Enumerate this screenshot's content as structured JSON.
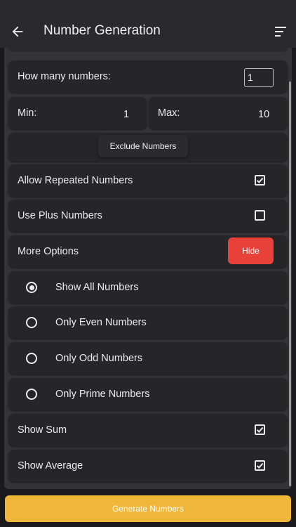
{
  "appbar": {
    "title": "Number Generation",
    "back_icon": "arrow-left-icon",
    "sort_icon": "sort-icon"
  },
  "settings": {
    "how_many_label": "How many numbers:",
    "how_many_value": "1",
    "min_label": "Min:",
    "min_value": "1",
    "max_label": "Max:",
    "max_value": "10",
    "exclude_label": "Exclude Numbers",
    "allow_repeated_label": "Allow Repeated Numbers",
    "allow_repeated_checked": true,
    "use_plus_label": "Use Plus Numbers",
    "use_plus_checked": false,
    "more_options_label": "More Options",
    "hide_label": "Hide"
  },
  "filters": {
    "options": [
      {
        "label": "Show All Numbers",
        "selected": true
      },
      {
        "label": "Only Even Numbers",
        "selected": false
      },
      {
        "label": "Only Odd Numbers",
        "selected": false
      },
      {
        "label": "Only Prime Numbers",
        "selected": false
      }
    ]
  },
  "extras": {
    "show_sum_label": "Show Sum",
    "show_sum_checked": true,
    "show_average_label": "Show Average",
    "show_average_checked": true
  },
  "footer": {
    "generate_label": "Generate Numbers"
  },
  "colors": {
    "accent_generate": "#efb63a",
    "accent_hide": "#e8413a",
    "card": "#262628",
    "panel": "#343436"
  }
}
